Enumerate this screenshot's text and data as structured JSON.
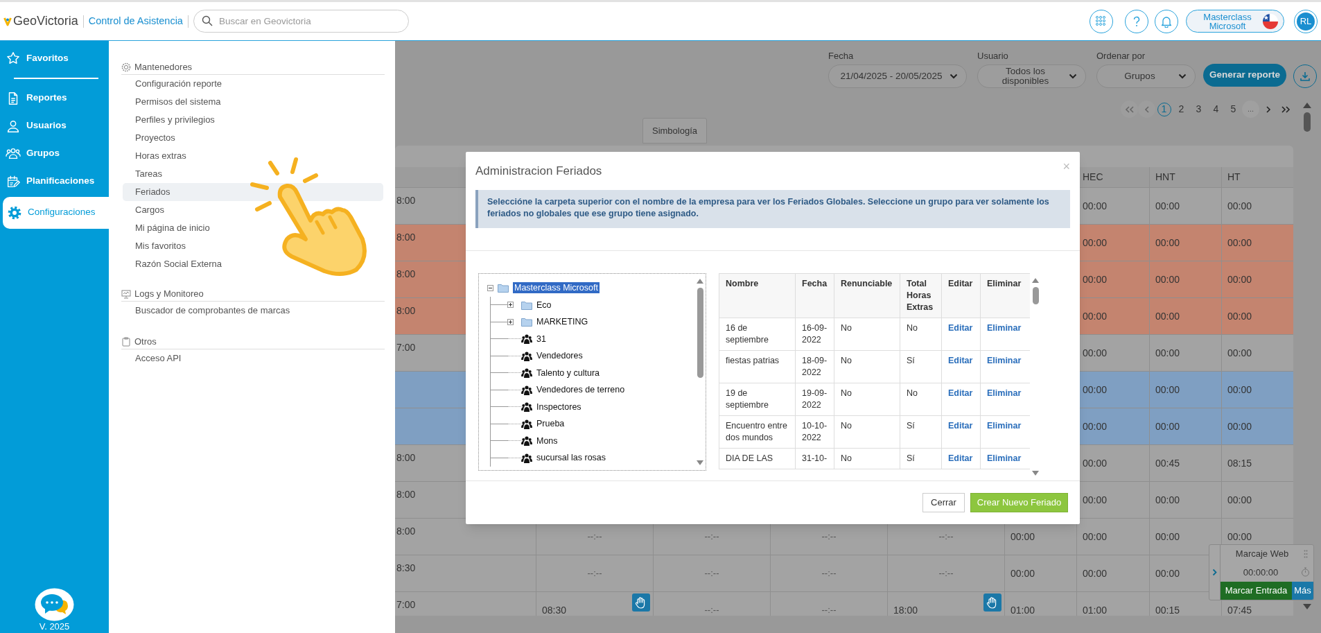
{
  "top_bar": {
    "logo": "GeoVictoria",
    "module": "Control de Asistencia",
    "search": {
      "placeholder": "Buscar en Geovictoria"
    },
    "account": "Masterclass Microsoft",
    "avatar": "RL"
  },
  "sidebar": {
    "items": [
      {
        "label": "Favoritos",
        "selected": false
      },
      {
        "label": "Reportes",
        "selected": false
      },
      {
        "label": "Usuarios",
        "selected": false
      },
      {
        "label": "Grupos",
        "selected": false
      },
      {
        "label": "Planificaciones",
        "selected": false
      },
      {
        "label": "Configuraciones",
        "selected": true
      }
    ],
    "version": "V. 2025"
  },
  "config_menu": {
    "sections": [
      {
        "title": "Mantenedores",
        "items": [
          {
            "label": "Configuración reporte",
            "selected": false
          },
          {
            "label": "Permisos del sistema",
            "selected": false
          },
          {
            "label": "Perfiles y privilegios",
            "selected": false
          },
          {
            "label": "Proyectos",
            "selected": false
          },
          {
            "label": "Horas extras",
            "selected": false
          },
          {
            "label": "Tareas",
            "selected": false
          },
          {
            "label": "Feriados",
            "selected": true
          },
          {
            "label": "Cargos",
            "selected": false
          },
          {
            "label": "Mi página de inicio",
            "selected": false
          },
          {
            "label": "Mis favoritos",
            "selected": false
          },
          {
            "label": "Razón Social Externa",
            "selected": false
          }
        ]
      },
      {
        "title": "Logs y Monitoreo",
        "items": [
          {
            "label": "Buscador de comprobantes de marcas",
            "selected": false
          }
        ]
      },
      {
        "title": "Otros",
        "items": [
          {
            "label": "Acceso API",
            "selected": false
          }
        ]
      }
    ]
  },
  "filters": [
    {
      "label": "Fecha",
      "value": "21/04/2025 - 20/05/2025"
    },
    {
      "label": "Usuario",
      "value": "Todos los disponibles"
    },
    {
      "label": "Ordenar por",
      "value": "Grupos"
    }
  ],
  "generate_button": "Generar reporte",
  "pagination": {
    "pages": [
      {
        "label": "1",
        "selected": true
      },
      {
        "label": "2",
        "selected": false
      },
      {
        "label": "3",
        "selected": false
      },
      {
        "label": "4",
        "selected": false
      },
      {
        "label": "5",
        "selected": false
      }
    ],
    "ellipsis": "..."
  },
  "symbology_tab": "Simbología",
  "report_table": {
    "columns": [
      "HEC",
      "HNT",
      "HT"
    ],
    "rows": [
      {
        "color": "#a3a3a3",
        "lead": "8:00",
        "cells": [
          {
            "kind": "time",
            "text": "00:00"
          },
          {
            "kind": "time",
            "text": "00:00"
          },
          {
            "kind": "time",
            "text": "00:00"
          }
        ]
      },
      {
        "color": "#c4846f",
        "lead": "8:00",
        "cells": [
          {
            "kind": "time",
            "text": "00:00"
          },
          {
            "kind": "time",
            "text": "00:00"
          },
          {
            "kind": "time",
            "text": "00:00"
          }
        ]
      },
      {
        "color": "#c4846f",
        "lead": "8:00",
        "cells": [
          {
            "kind": "time",
            "text": "00:00"
          },
          {
            "kind": "time",
            "text": "00:00"
          },
          {
            "kind": "time",
            "text": "00:00"
          }
        ]
      },
      {
        "color": "#c4846f",
        "lead": "8:00",
        "cells": [
          {
            "kind": "time",
            "text": "00:00"
          },
          {
            "kind": "time",
            "text": "00:00"
          },
          {
            "kind": "time",
            "text": "00:00"
          }
        ]
      },
      {
        "color": "#a3a3a3",
        "lead": "7:00",
        "cells": [
          {
            "kind": "time",
            "text": "00:00"
          },
          {
            "kind": "time",
            "text": "00:00"
          },
          {
            "kind": "time",
            "text": "00:00"
          }
        ]
      },
      {
        "color": "#7f9fc2",
        "cells": [
          {
            "kind": "time",
            "text": "00:00"
          },
          {
            "kind": "time",
            "text": "00:00"
          },
          {
            "kind": "time",
            "text": "00:00"
          }
        ]
      },
      {
        "color": "#7f9fc2",
        "cells": [
          {
            "kind": "time",
            "text": "00:00"
          },
          {
            "kind": "time",
            "text": "00:00"
          },
          {
            "kind": "time",
            "text": "00:00"
          }
        ]
      },
      {
        "color": "#a3a3a3",
        "lead": "8:00",
        "cells": [
          {
            "kind": "time",
            "text": "00:00"
          },
          {
            "kind": "time",
            "text": "00:45"
          },
          {
            "kind": "time",
            "text": "08:15"
          }
        ]
      },
      {
        "color": "#a3a3a3",
        "lead": "8:00",
        "cells": [
          {
            "kind": "time",
            "text": "00:00"
          },
          {
            "kind": "time",
            "text": "00:00"
          },
          {
            "kind": "time",
            "text": "00:00"
          }
        ]
      },
      {
        "color": "#a3a3a3",
        "lead": "8:00",
        "cells": [
          {
            "kind": "blank",
            "text": "--:--"
          },
          {
            "kind": "blank",
            "text": "--:--"
          },
          {
            "kind": "blank",
            "text": "--:--"
          },
          {
            "kind": "blank",
            "text": "--:--"
          },
          {
            "kind": "time",
            "text": "00:00"
          },
          {
            "kind": "time",
            "text": "00:00"
          },
          {
            "kind": "time",
            "text": "00:00"
          },
          {
            "kind": "time",
            "text": "00:00"
          }
        ]
      },
      {
        "color": "#a3a3a3",
        "lead": "8:30",
        "cells": [
          {
            "kind": "blank",
            "text": "--:--"
          },
          {
            "kind": "blank",
            "text": "--:--"
          },
          {
            "kind": "blank",
            "text": "--:--"
          },
          {
            "kind": "blank",
            "text": "--:--"
          },
          {
            "kind": "time",
            "text": "00:00"
          },
          {
            "kind": "time",
            "text": "00:00"
          },
          {
            "kind": "time",
            "text": "00:00"
          }
        ]
      },
      {
        "color": "#a3a3a3",
        "lead": "7:00",
        "cells": [
          {
            "kind": "manual",
            "text": "08:30"
          },
          {
            "kind": "blank",
            "text": "--:--"
          },
          {
            "kind": "blank",
            "text": "--:--"
          },
          {
            "kind": "manual",
            "text": "18:00"
          },
          {
            "kind": "time",
            "text": "01:00"
          },
          {
            "kind": "time",
            "text": "01:00"
          },
          {
            "kind": "time",
            "text": "00:15"
          },
          {
            "kind": "time",
            "text": "07:45"
          }
        ]
      }
    ]
  },
  "clock_widget": {
    "title": "Marcaje Web",
    "timer": "00:00:00",
    "clock_in_button": "Marcar Entrada",
    "more_button": "Más"
  },
  "modal": {
    "title": "Administracion Feriados",
    "close": "×",
    "info": "Seleccióne la carpeta superior con el nombre de la empresa para ver los Feriados Globales. Seleccione un grupo para ver solamente los feriados no globales que ese grupo tiene asignado.",
    "tree": {
      "label": "Masterclass Microsoft",
      "kind": "folder",
      "expanded": true,
      "selected": true,
      "children": [
        {
          "label": "Eco",
          "kind": "folder",
          "expanded": false,
          "selected": false
        },
        {
          "label": "MARKETING",
          "kind": "folder",
          "expanded": false,
          "selected": false
        },
        {
          "label": "31",
          "kind": "group",
          "selected": false
        },
        {
          "label": "Vendedores",
          "kind": "group",
          "selected": false
        },
        {
          "label": "Talento y cultura",
          "kind": "group",
          "selected": false
        },
        {
          "label": "Vendedores de terreno",
          "kind": "group",
          "selected": false
        },
        {
          "label": "Inspectores",
          "kind": "group",
          "selected": false
        },
        {
          "label": "Prueba",
          "kind": "group",
          "selected": false
        },
        {
          "label": "Mons",
          "kind": "group",
          "selected": false
        },
        {
          "label": "sucursal las rosas",
          "kind": "group",
          "selected": false
        }
      ]
    },
    "table": {
      "columns": [
        "Nombre",
        "Fecha",
        "Renunciable",
        "Total Horas Extras",
        "Editar",
        "Eliminar"
      ],
      "rows": [
        {
          "cells": [
            "16 de septiembre",
            "16-09-2022",
            "No",
            "No",
            "Editar",
            "Eliminar"
          ]
        },
        {
          "cells": [
            "fiestas patrias",
            "18-09-2022",
            "No",
            "Sí",
            "Editar",
            "Eliminar"
          ]
        },
        {
          "cells": [
            "19 de septiembre",
            "19-09-2022",
            "No",
            "No",
            "Editar",
            "Eliminar"
          ]
        },
        {
          "cells": [
            "Encuentro entre dos mundos",
            "10-10-2022",
            "No",
            "Sí",
            "Editar",
            "Eliminar"
          ]
        },
        {
          "cells": [
            "DIA DE LAS",
            "31-10-",
            "No",
            "Sí",
            "Editar",
            "Eliminar"
          ]
        }
      ]
    },
    "buttons": {
      "close": "Cerrar",
      "create": "Crear Nuevo Feriado"
    }
  }
}
